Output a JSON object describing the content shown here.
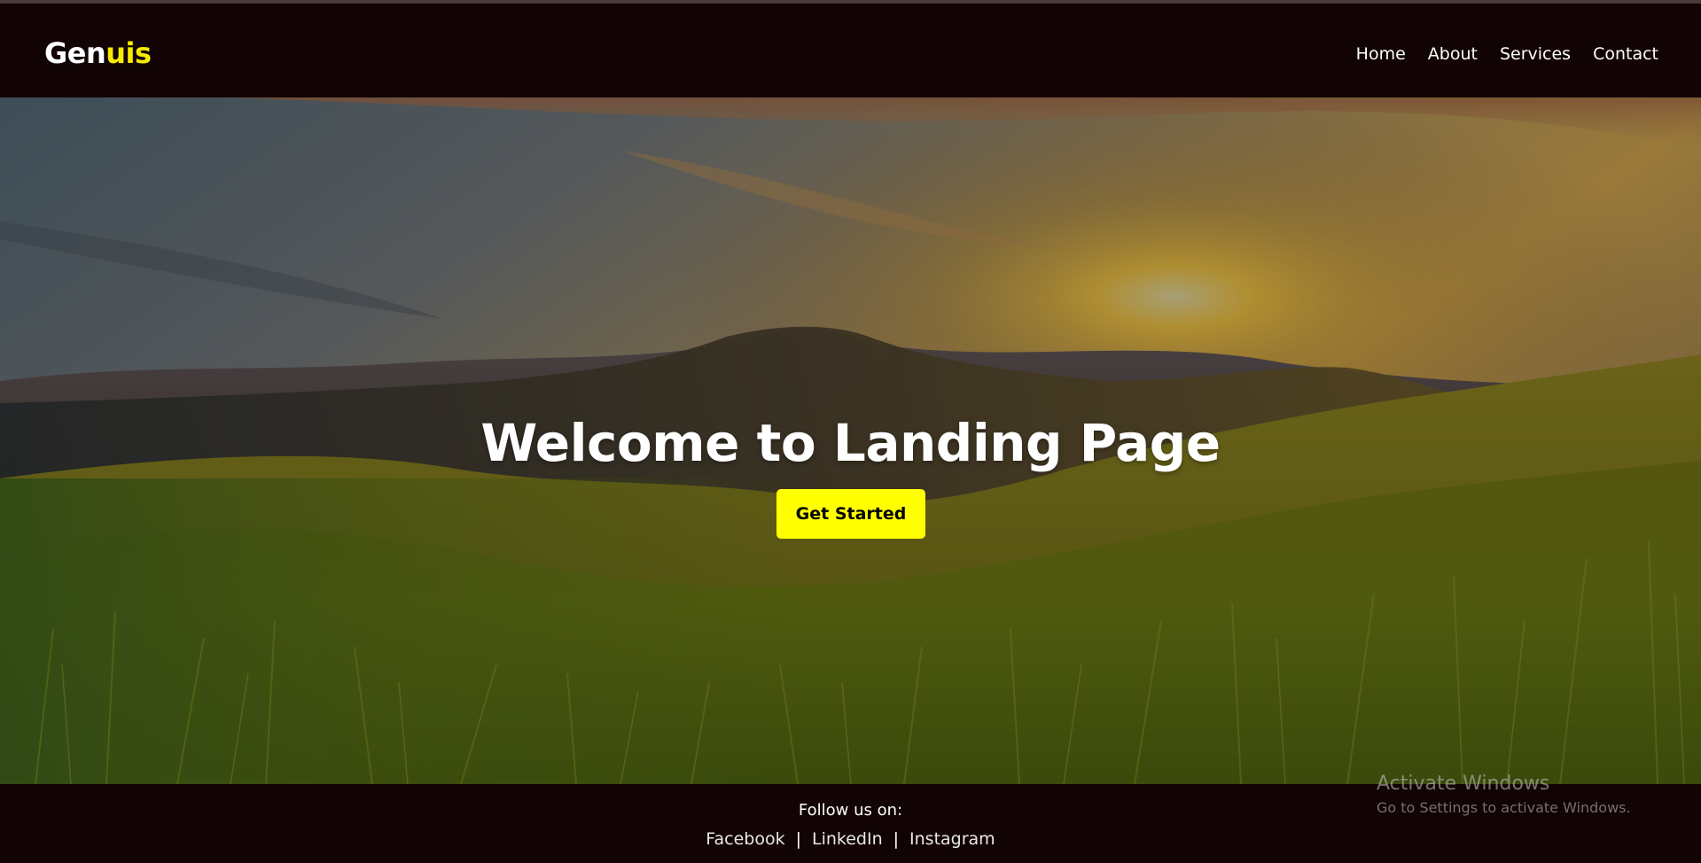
{
  "brand": {
    "logo_part_a": "Gen",
    "logo_part_b": "uis",
    "accent_color": "#f6ec00"
  },
  "nav": {
    "items": [
      {
        "label": "Home"
      },
      {
        "label": "About"
      },
      {
        "label": "Services"
      },
      {
        "label": "Contact"
      }
    ]
  },
  "hero": {
    "title": "Welcome to Landing Page",
    "cta_label": "Get Started",
    "background": "sunset-mountain-meadow-image"
  },
  "footer": {
    "follow_label": "Follow us on:",
    "links": [
      {
        "label": "Facebook"
      },
      {
        "label": "LinkedIn"
      },
      {
        "label": "Instagram"
      }
    ],
    "separator": "|"
  },
  "os_watermark": {
    "title": "Activate Windows",
    "subtitle": "Go to Settings to activate Windows."
  }
}
